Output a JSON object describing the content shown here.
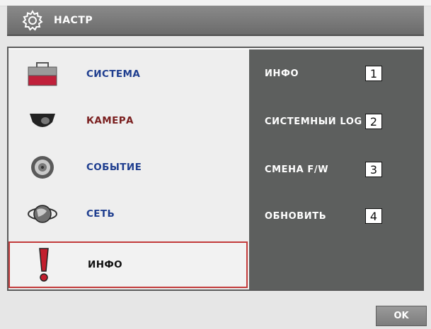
{
  "header": {
    "title": "НАСТР",
    "icon": "gear-icon"
  },
  "menu": {
    "items": [
      {
        "label": "СИСТЕМА",
        "icon": "toolbox-icon",
        "color": "#1f3e8f"
      },
      {
        "label": "КАМЕРА",
        "icon": "camera-icon",
        "color": "#7a1f1f"
      },
      {
        "label": "СОБЫТИЕ",
        "icon": "event-icon",
        "color": "#1f3e8f"
      },
      {
        "label": "СЕТЬ",
        "icon": "network-globe-icon",
        "color": "#1f3e8f"
      },
      {
        "label": "ИНФО",
        "icon": "exclamation-icon",
        "color": "#111111"
      }
    ],
    "selected": "ИНФО"
  },
  "submenu": {
    "items": [
      {
        "label": "ИНФО",
        "number": "1"
      },
      {
        "label": "СИСТЕМНЫЙ LOG",
        "number": "2"
      },
      {
        "label": "СМЕНА F/W",
        "number": "3"
      },
      {
        "label": "ОБНОВИТЬ",
        "number": "4"
      }
    ]
  },
  "footer": {
    "ok_label": "OK"
  }
}
